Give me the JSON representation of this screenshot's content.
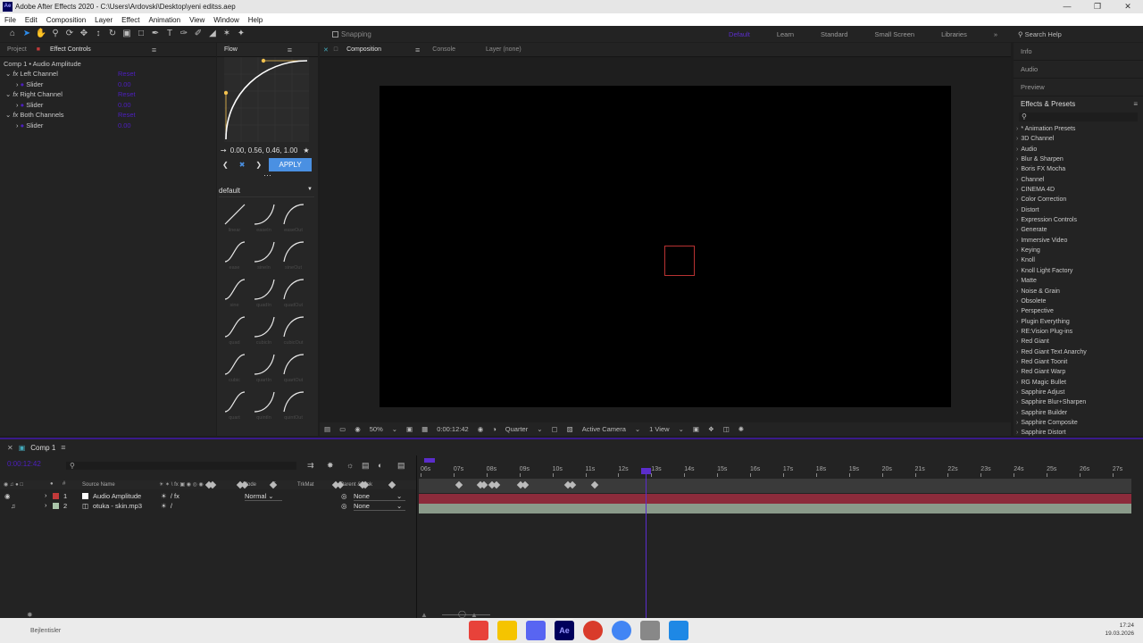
{
  "window": {
    "title": "Adobe After Effects 2020 - C:\\Users\\Ardovski\\Desktop\\yeni editss.aep"
  },
  "menu": [
    "File",
    "Edit",
    "Composition",
    "Layer",
    "Effect",
    "Animation",
    "View",
    "Window",
    "Help"
  ],
  "toolbar": {
    "snapping_label": "Snapping"
  },
  "workspaces": [
    "Default",
    "Learn",
    "Standard",
    "Small Screen",
    "Libraries"
  ],
  "search_help": "Search Help",
  "left_panel": {
    "tabs": [
      "Project",
      "Effect Controls"
    ],
    "header": "Comp 1 • Audio Amplitude",
    "rows": [
      {
        "label": "Left Channel",
        "value": "Reset"
      },
      {
        "label": "Slider",
        "value": "0.00"
      },
      {
        "label": "Right Channel",
        "value": "Reset"
      },
      {
        "label": "Slider",
        "value": "0.00"
      },
      {
        "label": "Both Channels",
        "value": "Reset"
      },
      {
        "label": "Slider",
        "value": "0.00"
      }
    ]
  },
  "flow": {
    "tab": "Flow",
    "easing": "0.00, 0.56, 0.46, 1.00",
    "apply_label": "APPLY",
    "preset_group": "default",
    "presets": [
      "linear",
      "easeIn",
      "easeOut",
      "ease",
      "sineIn",
      "sineOut",
      "sine",
      "quadIn",
      "quadOut",
      "quad",
      "cubicIn",
      "cubicOut",
      "cubic",
      "quartIn",
      "quartOut",
      "quart",
      "quintIn",
      "quintOut"
    ]
  },
  "composition": {
    "tabs": [
      "Composition",
      "Console",
      "Layer (none)"
    ],
    "zoom": "50%",
    "timecode": "0:00:12:42",
    "resolution": "Quarter",
    "camera": "Active Camera",
    "views": "1 View"
  },
  "right_panel": {
    "sections": [
      "Info",
      "Audio",
      "Preview"
    ],
    "effects_title": "Effects & Presets",
    "effects": [
      "* Animation Presets",
      "3D Channel",
      "Audio",
      "Blur & Sharpen",
      "Boris FX Mocha",
      "Channel",
      "CINEMA 4D",
      "Color Correction",
      "Distort",
      "Expression Controls",
      "Generate",
      "Immersive Video",
      "Keying",
      "Knoll",
      "Knoll Light Factory",
      "Matte",
      "Noise & Grain",
      "Obsolete",
      "Perspective",
      "Plugin Everything",
      "RE:Vision Plug-ins",
      "Red Giant",
      "Red Giant Text Anarchy",
      "Red Giant Toonit",
      "Red Giant Warp",
      "RG Magic Bullet",
      "Sapphire Adjust",
      "Sapphire Blur+Sharpen",
      "Sapphire Builder",
      "Sapphire Composite",
      "Sapphire Distort"
    ]
  },
  "timeline": {
    "tab": "Comp 1",
    "current_time": "0:00:12:42",
    "columns": {
      "source": "Source Name",
      "mode": "Mode",
      "trkmat": "TrkMat",
      "parent": "Parent & Link"
    },
    "layers": [
      {
        "index": "1",
        "name": "Audio Amplitude",
        "mode": "Normal",
        "parent": "None",
        "color": "#c23a3a"
      },
      {
        "index": "2",
        "name": "otuka - skin.mp3",
        "mode": "",
        "parent": "None",
        "color": "#a9c4a9"
      }
    ],
    "ruler": [
      "06s",
      "07s",
      "08s",
      "09s",
      "10s",
      "11s",
      "12s",
      "13s",
      "14s",
      "15s",
      "16s",
      "17s",
      "18s",
      "19s",
      "20s",
      "21s",
      "22s",
      "23s",
      "24s",
      "25s",
      "26s",
      "27s"
    ]
  },
  "taskbar": {
    "label": "Bejlentisler",
    "time": "17:24",
    "date": "19.03.2026"
  }
}
